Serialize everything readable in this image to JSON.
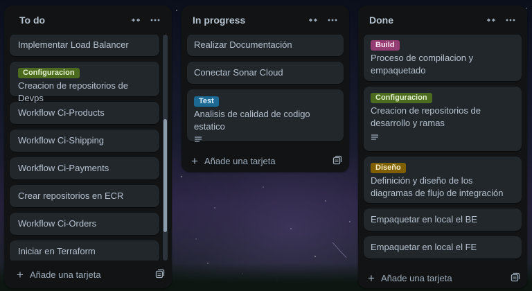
{
  "board": {
    "lists": [
      {
        "title": "To do",
        "cards": [
          {
            "title": "Implementar Load Balancer"
          },
          {
            "title": "Creacion de repositorios de Devps",
            "label": {
              "text": "Configuracion",
              "color": "green"
            }
          },
          {
            "title": "Workflow Ci-Products"
          },
          {
            "title": "Workflow Ci-Shipping"
          },
          {
            "title": "Workflow Ci-Payments"
          },
          {
            "title": "Crear repositorios en ECR"
          },
          {
            "title": "Workflow Ci-Orders"
          },
          {
            "title": "Iniciar en Terraform"
          }
        ],
        "add_label": "Añade una tarjeta"
      },
      {
        "title": "In progress",
        "cards": [
          {
            "title": "Realizar Documentación"
          },
          {
            "title": "Conectar Sonar Cloud"
          },
          {
            "title": "Analisis de calidad de codigo estatico",
            "label": {
              "text": "Test",
              "color": "blue"
            },
            "has_description": true
          }
        ],
        "add_label": "Añade una tarjeta"
      },
      {
        "title": "Done",
        "cards": [
          {
            "title": "Proceso de compilacion y empaquetado",
            "label": {
              "text": "Build",
              "color": "pink"
            }
          },
          {
            "title": "Creacion de repositorios de desarrollo y ramas",
            "label": {
              "text": "Configuracion",
              "color": "green"
            },
            "has_description": true
          },
          {
            "title": "Definición y diseño de los diagramas de flujo de integración",
            "label": {
              "text": "Diseño",
              "color": "yellow"
            }
          },
          {
            "title": "Empaquetar en local el BE"
          },
          {
            "title": "Empaquetar en local el FE"
          }
        ],
        "add_label": "Añade una tarjeta"
      }
    ],
    "colors": {
      "list_bg": "#111314",
      "card_bg": "#22272b",
      "text": "#b6c2cf",
      "label_green": "#4c6b1f",
      "label_blue": "#1c6a94",
      "label_pink": "#943d73",
      "label_yellow": "#7f5f01"
    },
    "icons": {
      "collapse": "collapse-arrows-icon",
      "more": "ellipsis-icon",
      "add": "plus-icon",
      "template": "card-template-icon",
      "description": "description-lines-icon"
    },
    "todo_scroll": {
      "position_fraction": 0.55,
      "visible_fraction": 0.5
    }
  }
}
